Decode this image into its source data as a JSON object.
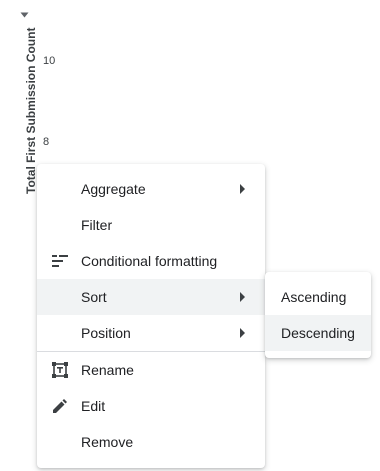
{
  "chart": {
    "y_axis_title": "Total First Submission Count",
    "y_ticks": [
      "10",
      "8"
    ]
  },
  "context_menu": {
    "items": [
      {
        "label": "Aggregate",
        "has_submenu": true
      },
      {
        "label": "Filter"
      },
      {
        "label": "Conditional formatting",
        "icon": "conditional-formatting-icon"
      },
      {
        "label": "Sort",
        "has_submenu": true,
        "highlighted": true
      },
      {
        "label": "Position",
        "has_submenu": true
      },
      {
        "label": "Rename",
        "icon": "rename-icon"
      },
      {
        "label": "Edit",
        "icon": "pencil-icon"
      },
      {
        "label": "Remove"
      }
    ]
  },
  "sort_submenu": {
    "items": [
      {
        "label": "Ascending"
      },
      {
        "label": "Descending",
        "highlighted": true
      }
    ]
  },
  "colors": {
    "highlight": "#f1f3f4",
    "text": "#202124",
    "divider": "#dadce0"
  }
}
